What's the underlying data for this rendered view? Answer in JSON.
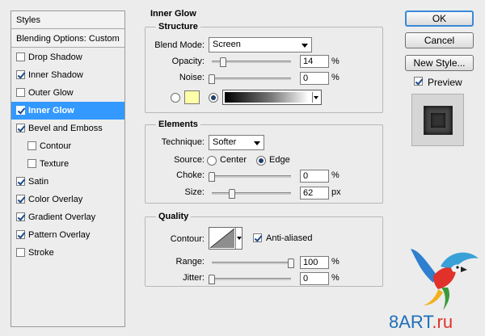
{
  "styles_panel": {
    "header": "Styles",
    "blending": "Blending Options: Custom",
    "items": [
      {
        "label": "Drop Shadow",
        "checked": false,
        "indent": false,
        "selected": false
      },
      {
        "label": "Inner Shadow",
        "checked": true,
        "indent": false,
        "selected": false
      },
      {
        "label": "Outer Glow",
        "checked": false,
        "indent": false,
        "selected": false
      },
      {
        "label": "Inner Glow",
        "checked": true,
        "indent": false,
        "selected": true
      },
      {
        "label": "Bevel and Emboss",
        "checked": true,
        "indent": false,
        "selected": false
      },
      {
        "label": "Contour",
        "checked": false,
        "indent": true,
        "selected": false
      },
      {
        "label": "Texture",
        "checked": false,
        "indent": true,
        "selected": false
      },
      {
        "label": "Satin",
        "checked": true,
        "indent": false,
        "selected": false
      },
      {
        "label": "Color Overlay",
        "checked": true,
        "indent": false,
        "selected": false
      },
      {
        "label": "Gradient Overlay",
        "checked": true,
        "indent": false,
        "selected": false
      },
      {
        "label": "Pattern Overlay",
        "checked": true,
        "indent": false,
        "selected": false
      },
      {
        "label": "Stroke",
        "checked": false,
        "indent": false,
        "selected": false
      }
    ]
  },
  "panel_title": "Inner Glow",
  "structure": {
    "title": "Structure",
    "blend_mode_label": "Blend Mode:",
    "blend_mode_value": "Screen",
    "opacity_label": "Opacity:",
    "opacity_value": "14",
    "opacity_unit": "%",
    "opacity_level": 0.14,
    "noise_label": "Noise:",
    "noise_value": "0",
    "noise_unit": "%",
    "noise_level": 0,
    "glow_color": "#ffffa8"
  },
  "elements": {
    "title": "Elements",
    "technique_label": "Technique:",
    "technique_value": "Softer",
    "source_label": "Source:",
    "source_center": "Center",
    "source_edge": "Edge",
    "choke_label": "Choke:",
    "choke_value": "0",
    "choke_unit": "%",
    "choke_level": 0,
    "size_label": "Size:",
    "size_value": "62",
    "size_unit": "px",
    "size_level": 0.25
  },
  "quality": {
    "title": "Quality",
    "contour_label": "Contour:",
    "anti_aliased_label": "Anti-aliased",
    "range_label": "Range:",
    "range_value": "100",
    "range_unit": "%",
    "range_level": 1.0,
    "jitter_label": "Jitter:",
    "jitter_value": "0",
    "jitter_unit": "%",
    "jitter_level": 0
  },
  "buttons": {
    "ok": "OK",
    "cancel": "Cancel",
    "new_style": "New Style...",
    "preview": "Preview"
  },
  "watermark": {
    "text_prefix": "8ART",
    "text_suffix": ".ru"
  }
}
